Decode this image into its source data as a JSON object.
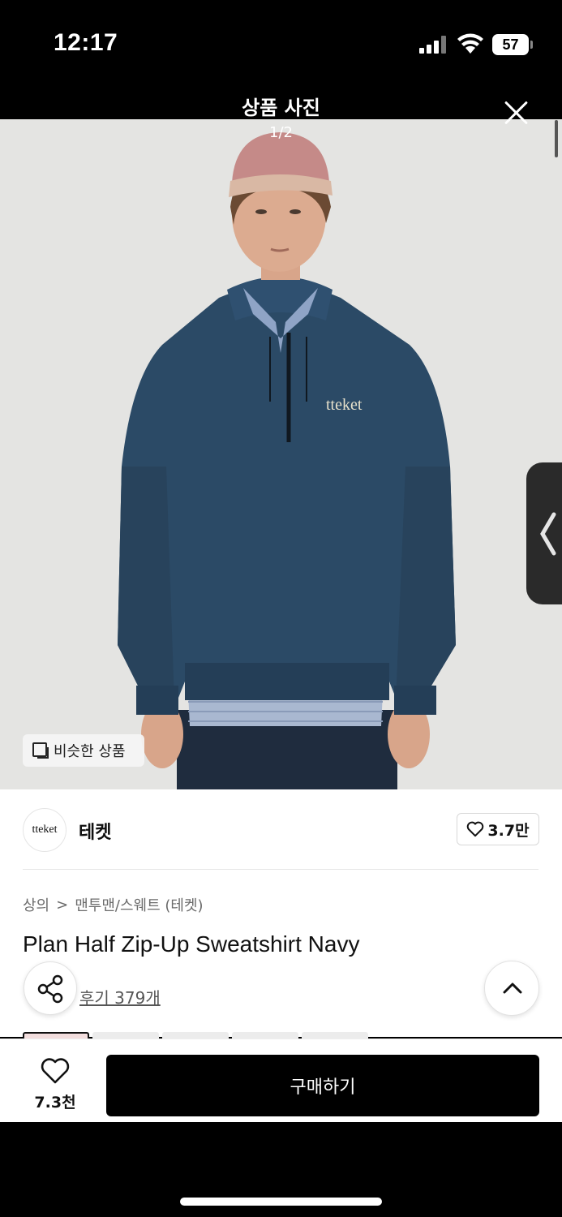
{
  "status": {
    "time": "12:17",
    "battery": "57"
  },
  "viewer": {
    "title": "상품 사진",
    "counter": "1/2"
  },
  "photo": {
    "logo_text": "tteket",
    "similar_label": "비슷한 상품"
  },
  "brand": {
    "logo_text": "tteket",
    "name": "테켓",
    "likes": "3.7만"
  },
  "breadcrumb": {
    "category": "상의",
    "separator": ">",
    "subcategory": "맨투맨/스웨트 (테켓)"
  },
  "product": {
    "title": "Plan Half Zip-Up Sweatshirt Navy",
    "reviews": "후기 379개"
  },
  "buy_bar": {
    "wish_count": "7.3천",
    "buy_label": "구매하기"
  },
  "icons": {
    "close": "close-icon",
    "share": "share-icon",
    "top": "chevron-up-icon",
    "heart": "heart-icon",
    "side": "chevron-left-icon",
    "similar": "similar-items-icon"
  },
  "colors": {
    "accent": "#000000",
    "sweatshirt": "#2b4a66",
    "background": "#e4e4e2"
  }
}
